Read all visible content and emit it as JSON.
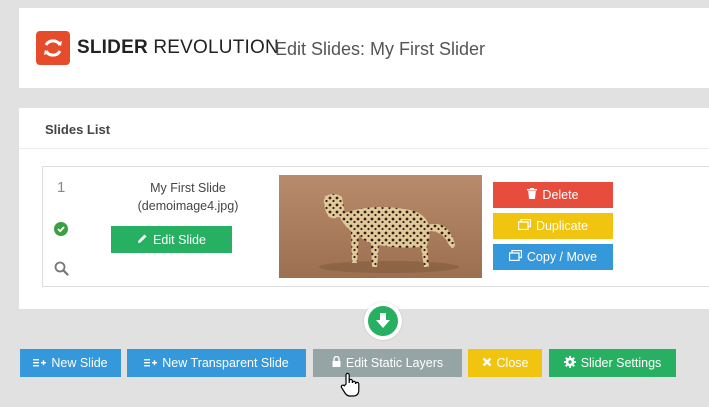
{
  "header": {
    "brand_bold": "SLIDER",
    "brand_rest": "REVOLUTION",
    "page_title": "Edit Slides: My First Slider"
  },
  "slides_list": {
    "title": "Slides List",
    "slides": [
      {
        "number": "1",
        "name": "My First Slide",
        "filename": "(demoimage4.jpg)",
        "edit_label": "Edit Slide",
        "actions": {
          "delete": "Delete",
          "duplicate": "Duplicate",
          "copy_move": "Copy / Move"
        }
      }
    ]
  },
  "toolbar": {
    "new_slide": "New Slide",
    "new_transparent_slide": "New Transparent Slide",
    "edit_static_layers": "Edit Static Layers",
    "close": "Close",
    "slider_settings": "Slider Settings"
  },
  "colors": {
    "brand": "#e64c2b",
    "green": "#27b062",
    "blue": "#3498db",
    "red": "#e74c3c",
    "yellow": "#f1c40f",
    "gray": "#95a5a6"
  }
}
